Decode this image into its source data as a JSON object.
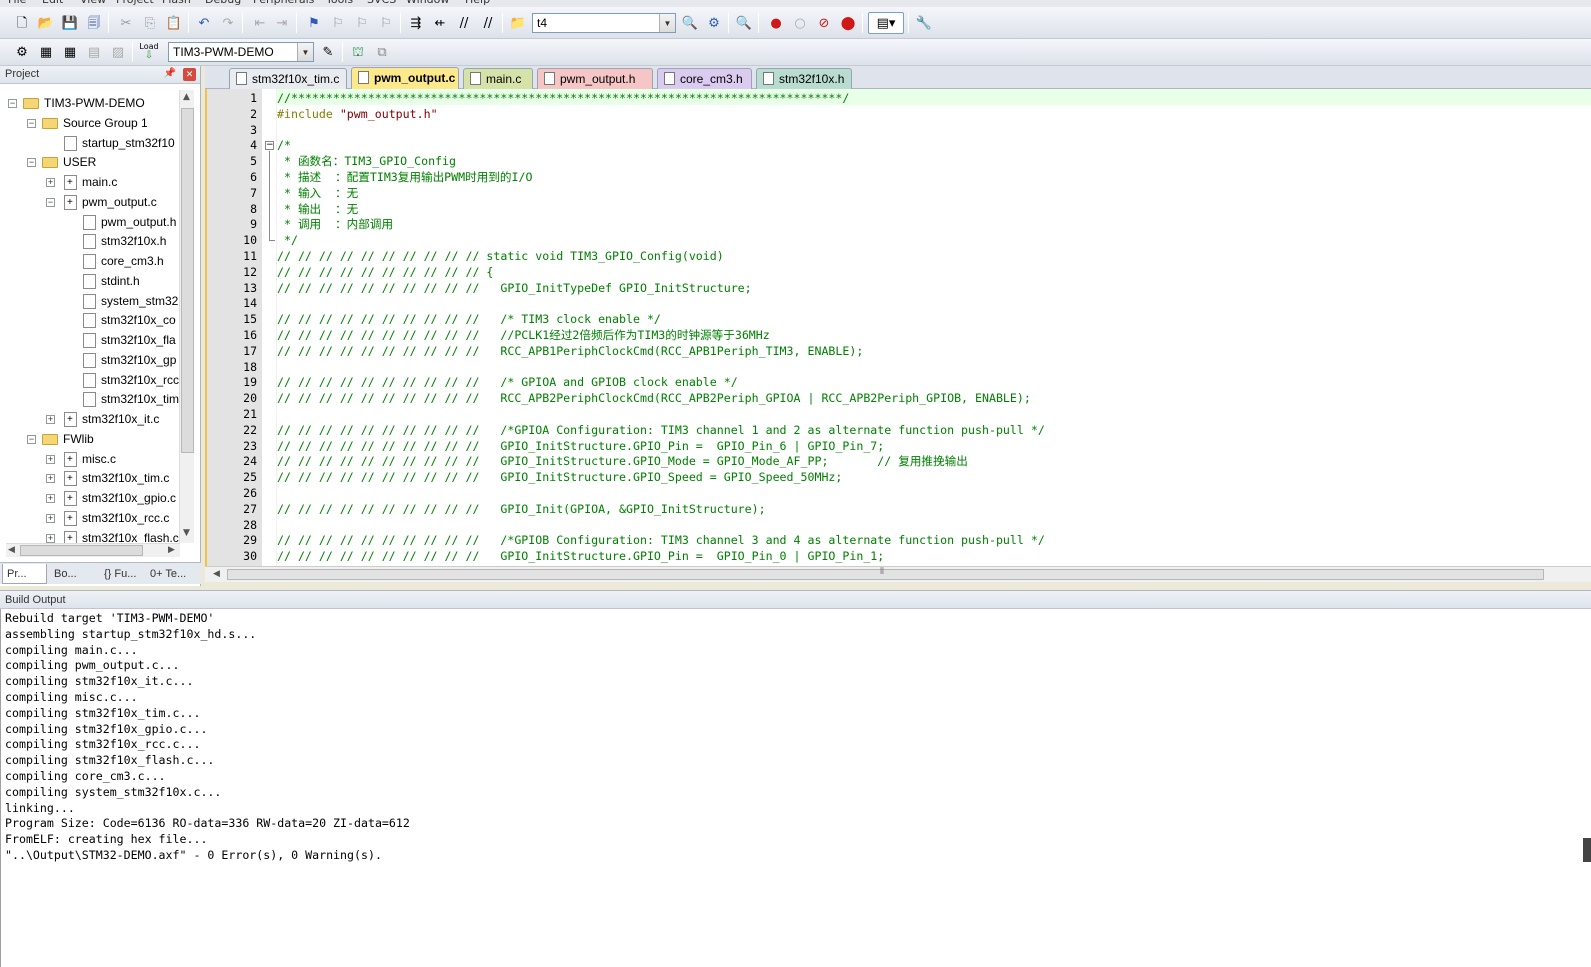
{
  "menu": [
    "File",
    "Edit",
    "View",
    "Project",
    "Flash",
    "Debug",
    "Peripherals",
    "Tools",
    "SVCS",
    "Window",
    "Help"
  ],
  "toolbar": {
    "find_value": "t4",
    "target_value": "TIM3-PWM-DEMO",
    "load_label": "Load"
  },
  "project_panel": {
    "title": "Project",
    "tree": [
      {
        "label": "TIM3-PWM-DEMO",
        "level": 0,
        "kind": "root",
        "exp": "-"
      },
      {
        "label": "Source Group 1",
        "level": 1,
        "kind": "folder",
        "exp": "-"
      },
      {
        "label": "startup_stm32f10",
        "level": 2,
        "kind": "file",
        "exp": ""
      },
      {
        "label": "USER",
        "level": 1,
        "kind": "folder",
        "exp": "-"
      },
      {
        "label": "main.c",
        "level": 2,
        "kind": "cfile",
        "exp": "+"
      },
      {
        "label": "pwm_output.c",
        "level": 2,
        "kind": "cfile",
        "exp": "-"
      },
      {
        "label": "pwm_output.h",
        "level": 3,
        "kind": "file",
        "exp": ""
      },
      {
        "label": "stm32f10x.h",
        "level": 3,
        "kind": "file",
        "exp": ""
      },
      {
        "label": "core_cm3.h",
        "level": 3,
        "kind": "file",
        "exp": ""
      },
      {
        "label": "stdint.h",
        "level": 3,
        "kind": "file",
        "exp": ""
      },
      {
        "label": "system_stm32",
        "level": 3,
        "kind": "file",
        "exp": ""
      },
      {
        "label": "stm32f10x_co",
        "level": 3,
        "kind": "file",
        "exp": ""
      },
      {
        "label": "stm32f10x_fla",
        "level": 3,
        "kind": "file",
        "exp": ""
      },
      {
        "label": "stm32f10x_gp",
        "level": 3,
        "kind": "file",
        "exp": ""
      },
      {
        "label": "stm32f10x_rcc",
        "level": 3,
        "kind": "file",
        "exp": ""
      },
      {
        "label": "stm32f10x_tim",
        "level": 3,
        "kind": "file",
        "exp": ""
      },
      {
        "label": "stm32f10x_it.c",
        "level": 2,
        "kind": "cfile",
        "exp": "+"
      },
      {
        "label": "FWlib",
        "level": 1,
        "kind": "folder",
        "exp": "-"
      },
      {
        "label": "misc.c",
        "level": 2,
        "kind": "cfile",
        "exp": "+"
      },
      {
        "label": "stm32f10x_tim.c",
        "level": 2,
        "kind": "cfile",
        "exp": "+"
      },
      {
        "label": "stm32f10x_gpio.c",
        "level": 2,
        "kind": "cfile",
        "exp": "+"
      },
      {
        "label": "stm32f10x_rcc.c",
        "level": 2,
        "kind": "cfile",
        "exp": "+"
      },
      {
        "label": "stm32f10x_flash.c",
        "level": 2,
        "kind": "cfile",
        "exp": "+"
      }
    ],
    "tabs": [
      "Pr...",
      "Bo...",
      "{} Fu...",
      "0+ Te..."
    ]
  },
  "editor": {
    "tabs": [
      {
        "label": "stm32f10x_tim.c",
        "color": "#e8ebf0",
        "active": false
      },
      {
        "label": "pwm_output.c",
        "color": "#fbe98c",
        "active": true
      },
      {
        "label": "main.c",
        "color": "#d6e3a8",
        "active": false
      },
      {
        "label": "pwm_output.h",
        "color": "#f6c6c6",
        "active": false
      },
      {
        "label": "core_cm3.h",
        "color": "#dccbf0",
        "active": false
      },
      {
        "label": "stm32f10x.h",
        "color": "#b9dcd0",
        "active": false
      }
    ],
    "lines": [
      {
        "n": "1",
        "text": "//*******************************************************************************/",
        "kind": "comment"
      },
      {
        "n": "2",
        "text": "#include \"pwm_output.h\"",
        "kind": "pre"
      },
      {
        "n": "3",
        "text": "",
        "kind": "comment"
      },
      {
        "n": "4",
        "text": "/*",
        "kind": "comment"
      },
      {
        "n": "5",
        "text": " * 函数名：TIM3_GPIO_Config",
        "kind": "comment"
      },
      {
        "n": "6",
        "text": " * 描述  ：配置TIM3复用输出PWM时用到的I/O",
        "kind": "comment"
      },
      {
        "n": "7",
        "text": " * 输入  ：无",
        "kind": "comment"
      },
      {
        "n": "8",
        "text": " * 输出  ：无",
        "kind": "comment"
      },
      {
        "n": "9",
        "text": " * 调用  ：内部调用",
        "kind": "comment"
      },
      {
        "n": "10",
        "text": " */",
        "kind": "comment"
      },
      {
        "n": "11",
        "text": "// // // // // // // // // // static void TIM3_GPIO_Config(void)",
        "kind": "comment"
      },
      {
        "n": "12",
        "text": "// // // // // // // // // // {",
        "kind": "comment"
      },
      {
        "n": "13",
        "text": "// // // // // // // // // //   GPIO_InitTypeDef GPIO_InitStructure;",
        "kind": "comment"
      },
      {
        "n": "14",
        "text": "",
        "kind": "comment"
      },
      {
        "n": "15",
        "text": "// // // // // // // // // //   /* TIM3 clock enable */",
        "kind": "comment"
      },
      {
        "n": "16",
        "text": "// // // // // // // // // //   //PCLK1经过2倍频后作为TIM3的时钟源等于36MHz",
        "kind": "comment"
      },
      {
        "n": "17",
        "text": "// // // // // // // // // //   RCC_APB1PeriphClockCmd(RCC_APB1Periph_TIM3, ENABLE);",
        "kind": "comment"
      },
      {
        "n": "18",
        "text": "",
        "kind": "comment"
      },
      {
        "n": "19",
        "text": "// // // // // // // // // //   /* GPIOA and GPIOB clock enable */",
        "kind": "comment"
      },
      {
        "n": "20",
        "text": "// // // // // // // // // //   RCC_APB2PeriphClockCmd(RCC_APB2Periph_GPIOA | RCC_APB2Periph_GPIOB, ENABLE);",
        "kind": "comment"
      },
      {
        "n": "21",
        "text": "",
        "kind": "comment"
      },
      {
        "n": "22",
        "text": "// // // // // // // // // //   /*GPIOA Configuration: TIM3 channel 1 and 2 as alternate function push-pull */",
        "kind": "comment"
      },
      {
        "n": "23",
        "text": "// // // // // // // // // //   GPIO_InitStructure.GPIO_Pin =  GPIO_Pin_6 | GPIO_Pin_7;",
        "kind": "comment"
      },
      {
        "n": "24",
        "text": "// // // // // // // // // //   GPIO_InitStructure.GPIO_Mode = GPIO_Mode_AF_PP;       // 复用推挽输出",
        "kind": "comment"
      },
      {
        "n": "25",
        "text": "// // // // // // // // // //   GPIO_InitStructure.GPIO_Speed = GPIO_Speed_50MHz;",
        "kind": "comment"
      },
      {
        "n": "26",
        "text": "",
        "kind": "comment"
      },
      {
        "n": "27",
        "text": "// // // // // // // // // //   GPIO_Init(GPIOA, &GPIO_InitStructure);",
        "kind": "comment"
      },
      {
        "n": "28",
        "text": "",
        "kind": "comment"
      },
      {
        "n": "29",
        "text": "// // // // // // // // // //   /*GPIOB Configuration: TIM3 channel 3 and 4 as alternate function push-pull */",
        "kind": "comment"
      },
      {
        "n": "30",
        "text": "// // // // // // // // // //   GPIO_InitStructure.GPIO_Pin =  GPIO_Pin_0 | GPIO_Pin_1;",
        "kind": "comment"
      }
    ]
  },
  "build_output": {
    "title": "Build Output",
    "lines": [
      "Rebuild target 'TIM3-PWM-DEMO'",
      "assembling startup_stm32f10x_hd.s...",
      "compiling main.c...",
      "compiling pwm_output.c...",
      "compiling stm32f10x_it.c...",
      "compiling misc.c...",
      "compiling stm32f10x_tim.c...",
      "compiling stm32f10x_gpio.c...",
      "compiling stm32f10x_rcc.c...",
      "compiling stm32f10x_flash.c...",
      "compiling core_cm3.c...",
      "compiling system_stm32f10x.c...",
      "linking...",
      "Program Size: Code=6136 RO-data=336 RW-data=20 ZI-data=612",
      "FromELF: creating hex file...",
      "\"..\\Output\\STM32-DEMO.axf\" - 0 Error(s), 0 Warning(s)."
    ]
  }
}
